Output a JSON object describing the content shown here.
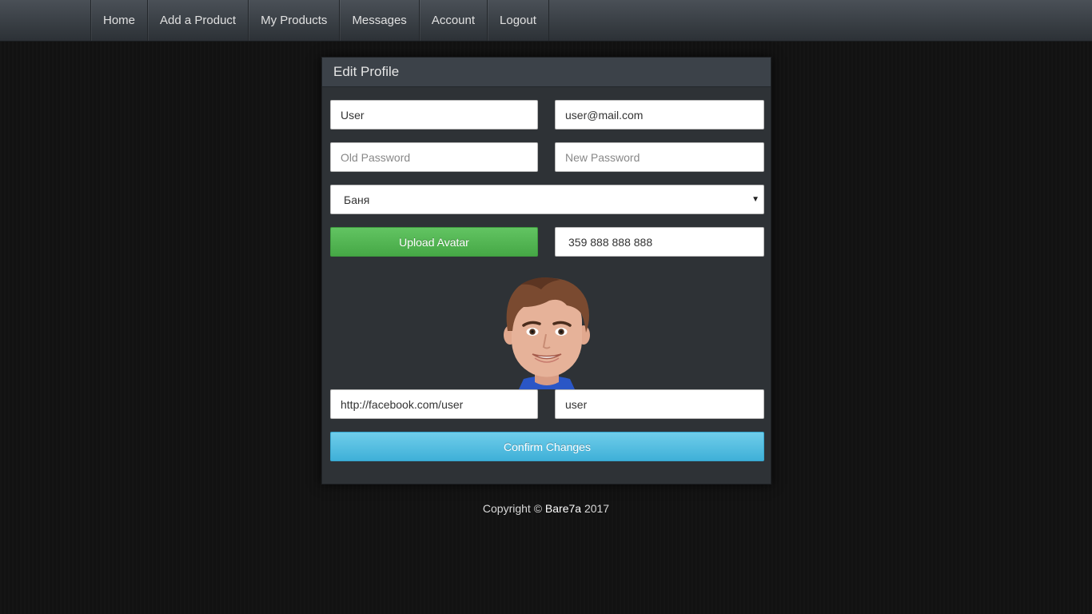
{
  "nav": {
    "items": [
      {
        "label": "Home"
      },
      {
        "label": "Add a Product"
      },
      {
        "label": "My Products"
      },
      {
        "label": "Messages"
      },
      {
        "label": "Account"
      },
      {
        "label": "Logout"
      }
    ]
  },
  "form": {
    "title": "Edit Profile",
    "username": {
      "value": "User"
    },
    "email": {
      "value": "user@mail.com"
    },
    "old_password": {
      "placeholder": "Old Password"
    },
    "new_password": {
      "placeholder": "New Password"
    },
    "city_select": {
      "selected": "Баня"
    },
    "upload_avatar_label": "Upload Avatar",
    "phone": {
      "value": "359 888 888 888"
    },
    "facebook": {
      "value": "http://facebook.com/user"
    },
    "skype": {
      "value": "user"
    },
    "confirm_label": "Confirm Changes"
  },
  "footer": {
    "prefix": "Copyright ©",
    "brand": "Bare7a",
    "year": "2017"
  },
  "colors": {
    "background": "#121212",
    "panel": "#2e3236",
    "success": "#5cb85c",
    "info": "#5bc0de"
  }
}
